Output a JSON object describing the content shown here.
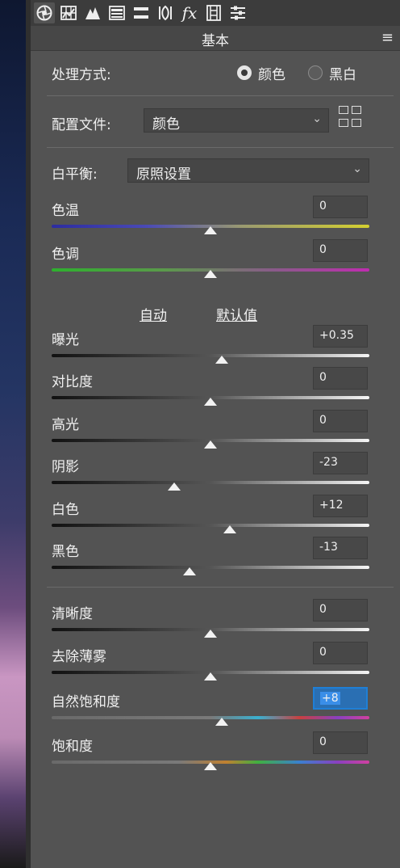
{
  "header": {
    "title": "基本"
  },
  "toolbar": {
    "icons": [
      "aperture-icon",
      "histogram-grid-icon",
      "tone-curve-icon",
      "detail-icon",
      "hsl-icon",
      "split-tone-icon",
      "fx-icon",
      "film-strip-icon",
      "sliders-icon"
    ]
  },
  "treatment": {
    "label": "处理方式:",
    "option_color": "颜色",
    "option_bw": "黑白",
    "selected": "颜色"
  },
  "profile": {
    "label": "配置文件:",
    "value": "颜色"
  },
  "white_balance": {
    "label": "白平衡:",
    "value": "原照设置"
  },
  "links": {
    "auto": "自动",
    "default": "默认值"
  },
  "sliders": [
    {
      "label": "色温",
      "value": "0",
      "level": 0.5
    },
    {
      "label": "色调",
      "value": "0",
      "level": 0.5
    },
    {
      "label": "曝光",
      "value": "+0.35",
      "level": 0.535
    },
    {
      "label": "对比度",
      "value": "0",
      "level": 0.5
    },
    {
      "label": "高光",
      "value": "0",
      "level": 0.5
    },
    {
      "label": "阴影",
      "value": "-23",
      "level": 0.385
    },
    {
      "label": "白色",
      "value": "+12",
      "level": 0.56
    },
    {
      "label": "黑色",
      "value": "-13",
      "level": 0.435
    },
    {
      "label": "清晰度",
      "value": "0",
      "level": 0.5
    },
    {
      "label": "去除薄雾",
      "value": "0",
      "level": 0.5
    },
    {
      "label": "自然饱和度",
      "value": "+8",
      "level": 0.535
    },
    {
      "label": "饱和度",
      "value": "0",
      "level": 0.5
    }
  ],
  "colors": {
    "temp_track": "linear-gradient(90deg,#2c2ca0,#4a4ab5 30%,#9a9a70 60%,#d4d030)",
    "tint_track": "linear-gradient(90deg,#2eb02e,#5a9a4a 35%,#8a5a8a 70%,#c02cb0)",
    "gray_track": "linear-gradient(90deg,#111 0%,#555 50%,#f5f5f5 100%)",
    "vib_track": "linear-gradient(90deg,#6a6a6a 0%,#7a7a7a 50%,#3ab0d0 65%,#c84040 78%,#8a40c0 90%,#d040a0 100%)"
  }
}
